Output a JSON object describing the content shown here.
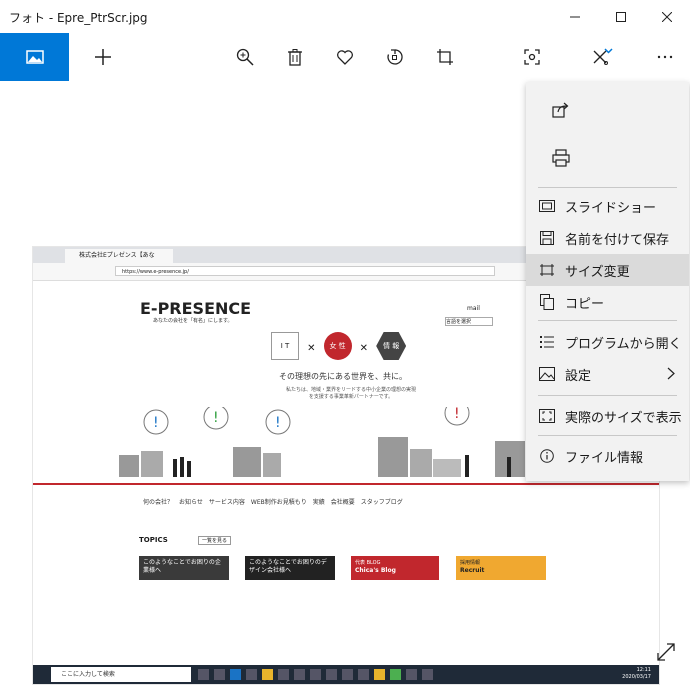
{
  "window": {
    "title": "フォト - Epre_PtrScr.jpg"
  },
  "menu": {
    "items": [
      {
        "label": "スライドショー",
        "icon": "slideshow-icon"
      },
      {
        "label": "名前を付けて保存",
        "icon": "save-icon"
      },
      {
        "label": "サイズ変更",
        "icon": "resize-icon"
      },
      {
        "label": "コピー",
        "icon": "copy-icon"
      },
      {
        "label": "プログラムから開く",
        "icon": "open-with-icon"
      },
      {
        "label": "設定",
        "icon": "settings-icon"
      },
      {
        "label": "実際のサイズで表示",
        "icon": "actual-size-icon"
      },
      {
        "label": "ファイル情報",
        "icon": "info-icon"
      }
    ]
  },
  "screenshot": {
    "tab_title": "株式会社Eプレゼンス【あな",
    "url": "https://www.e-presence.jp/",
    "logo": "E-PRESENCE",
    "logo_sub": "あなたの会社を「有名」にします。",
    "it_label": "I T",
    "female_label": "女 性",
    "info_label": "情 報",
    "tagline": "その理想の先にある世界を、共に。",
    "tagline2": "私たちは、地域・業界をリードする中小企業の理想の実現を支援する事業革新パートナーです。",
    "nav": "何の会社？　お知らせ　サービス内容　WEB制作お見積もり　実績　会社概要　スタッフブログ",
    "topics": "TOPICS",
    "topics_more": "一覧を見る",
    "card1": "このようなことでお困りの企業様へ",
    "card2": "このようなことでお困りのデザイン会社様へ",
    "card3_small": "代表 BLOG",
    "card3": "Chica's Blog",
    "card4_small": "採用情報",
    "card4": "Recruit",
    "taskbar_search": "ここに入力して検索",
    "clock_time": "12:11",
    "clock_date": "2020/03/17",
    "mail_label": "mail",
    "lang_select": "言語を選択"
  }
}
